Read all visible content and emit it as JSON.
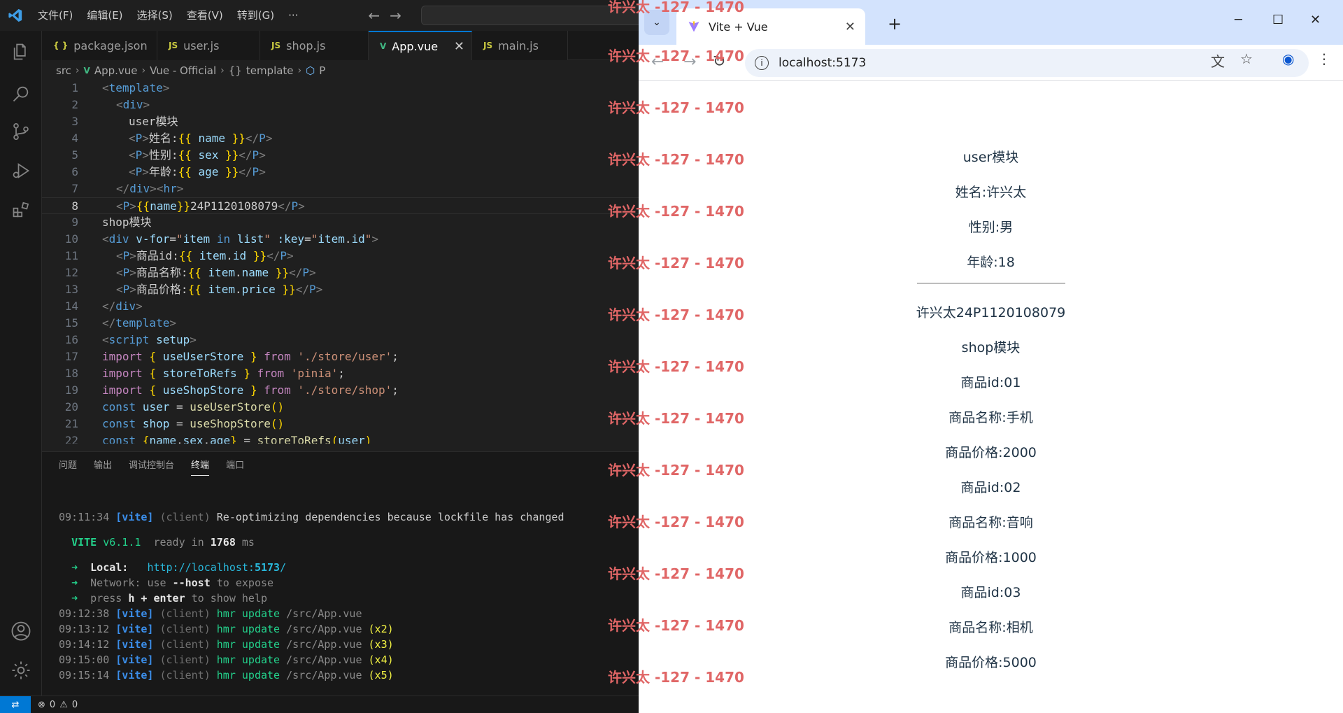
{
  "vscode": {
    "menu": [
      "文件(F)",
      "编辑(E)",
      "选择(S)",
      "查看(V)",
      "转到(G)",
      "···"
    ],
    "tabs": [
      {
        "label": "package.json",
        "icon": "{ }",
        "type": "json"
      },
      {
        "label": "user.js",
        "icon": "JS",
        "type": "js"
      },
      {
        "label": "shop.js",
        "icon": "JS",
        "type": "js"
      },
      {
        "label": "App.vue",
        "icon": "V",
        "type": "vue",
        "active": true
      },
      {
        "label": "main.js",
        "icon": "JS",
        "type": "js"
      }
    ],
    "breadcrumb": [
      "src",
      "App.vue",
      "Vue - Official",
      "template",
      "P"
    ],
    "line_numbers": [
      "1",
      "2",
      "3",
      "4",
      "5",
      "6",
      "7",
      "8",
      "9",
      "10",
      "11",
      "12",
      "13",
      "14",
      "15",
      "16",
      "17",
      "18",
      "19",
      "20",
      "21",
      "22"
    ],
    "current_line": "8",
    "panel_tabs": [
      "问题",
      "输出",
      "调试控制台",
      "终端",
      "端口"
    ],
    "active_panel_tab": "终端",
    "terminal": {
      "l1_time": "09:11:34",
      "l1_tag": "[vite]",
      "l1_client": "(client)",
      "l1_msg": "Re-optimizing dependencies because lockfile has changed",
      "vite_name": "VITE",
      "vite_version": "v6.1.1",
      "ready_text": "ready in",
      "ready_ms": "1768",
      "ms": "ms",
      "local_label": "Local:",
      "local_url_pre": "http://localhost:",
      "local_port": "5173",
      "local_url_post": "/",
      "network_label": "Network:",
      "network_text_a": "use",
      "network_flag": "--host",
      "network_text_b": "to expose",
      "help_a": "press",
      "help_key": "h + enter",
      "help_b": "to show help",
      "hmr": [
        {
          "time": "09:12:38",
          "file": "/src/App.vue",
          "count": ""
        },
        {
          "time": "09:13:12",
          "file": "/src/App.vue",
          "count": "(x2)"
        },
        {
          "time": "09:14:12",
          "file": "/src/App.vue",
          "count": "(x3)"
        },
        {
          "time": "09:15:00",
          "file": "/src/App.vue",
          "count": "(x4)"
        },
        {
          "time": "09:15:14",
          "file": "/src/App.vue",
          "count": "(x5)"
        }
      ],
      "hmr_text": "hmr update"
    },
    "status": {
      "errors": "0",
      "warnings": "0"
    }
  },
  "browser": {
    "tab_title": "Vite + Vue",
    "url": "localhost:5173",
    "page_lines": [
      "user模块",
      "姓名:许兴太",
      "性别:男",
      "年龄:18",
      "许兴太24P1120108079",
      "shop模块",
      "商品id:01",
      "商品名称:手机",
      "商品价格:2000",
      "商品id:02",
      "商品名称:音响",
      "商品价格:1000",
      "商品id:03",
      "商品名称:相机",
      "商品价格:5000"
    ]
  },
  "watermark": "许兴太 -127 - 1470"
}
